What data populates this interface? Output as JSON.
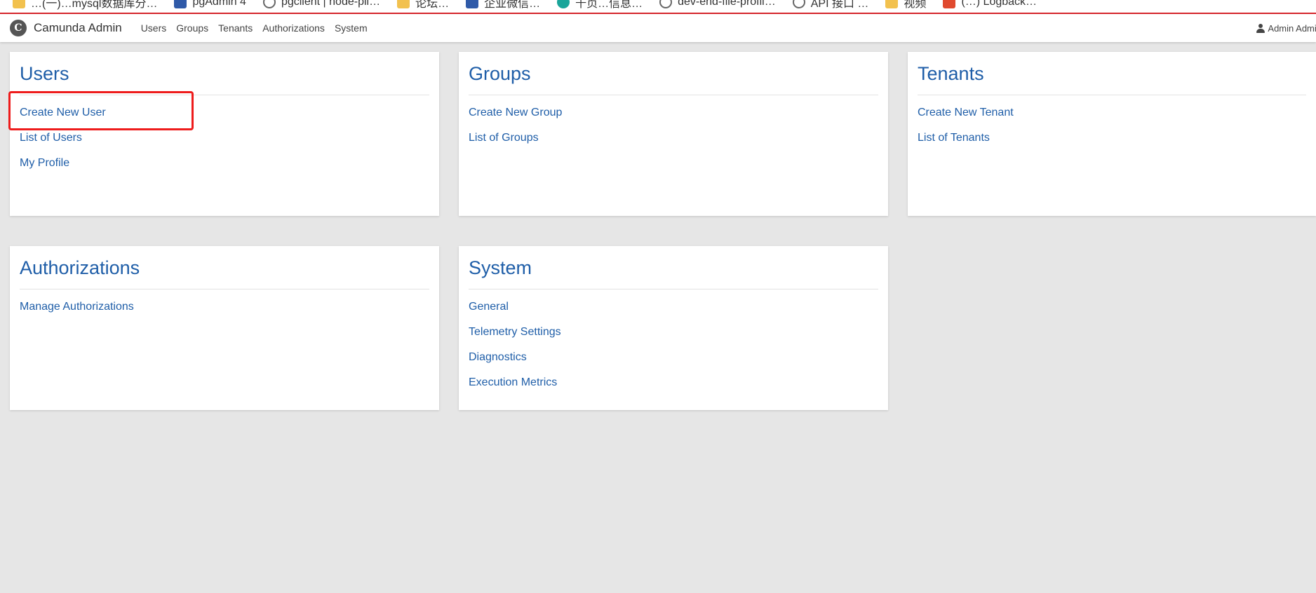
{
  "browser": {
    "bookmarks": [
      {
        "label": "…(一)…mysql数据库分…",
        "icon": "folder-icon"
      },
      {
        "label": "pgAdmin 4",
        "icon": "bookmark-blue-icon"
      },
      {
        "label": "pgclient | node-pil…",
        "icon": "globe-icon"
      },
      {
        "label": "论坛…",
        "icon": "folder-icon"
      },
      {
        "label": "企业微信…",
        "icon": "bookmark-blue-icon"
      },
      {
        "label": "千页…信息…",
        "icon": "teal-icon"
      },
      {
        "label": "dev-end-file-profil…",
        "icon": "globe-icon"
      },
      {
        "label": "API 接口 …",
        "icon": "globe-icon"
      },
      {
        "label": "视频",
        "icon": "folder-icon"
      },
      {
        "label": "(…) Logback…",
        "icon": "red-icon"
      }
    ]
  },
  "navbar": {
    "brand_name": "Camunda Admin",
    "brand_logo": "camunda-logo-icon",
    "links": [
      {
        "label": "Users"
      },
      {
        "label": "Groups"
      },
      {
        "label": "Tenants"
      },
      {
        "label": "Authorizations"
      },
      {
        "label": "System"
      }
    ],
    "user_menu": "Admin Admin",
    "user_icon": "user-icon"
  },
  "sections": {
    "users": {
      "title": "Users",
      "links": [
        "Create New User",
        "List of Users",
        "My Profile"
      ]
    },
    "groups": {
      "title": "Groups",
      "links": [
        "Create New Group",
        "List of Groups"
      ]
    },
    "tenants": {
      "title": "Tenants",
      "links": [
        "Create New Tenant",
        "List of Tenants"
      ]
    },
    "authorizations": {
      "title": "Authorizations",
      "links": [
        "Manage Authorizations"
      ]
    },
    "system": {
      "title": "System",
      "links": [
        "General",
        "Telemetry Settings",
        "Diagnostics",
        "Execution Metrics"
      ]
    }
  },
  "colors": {
    "accent": "#1f5ea8",
    "page_background": "#e6e6e6",
    "highlight": "#ee1c1c"
  }
}
